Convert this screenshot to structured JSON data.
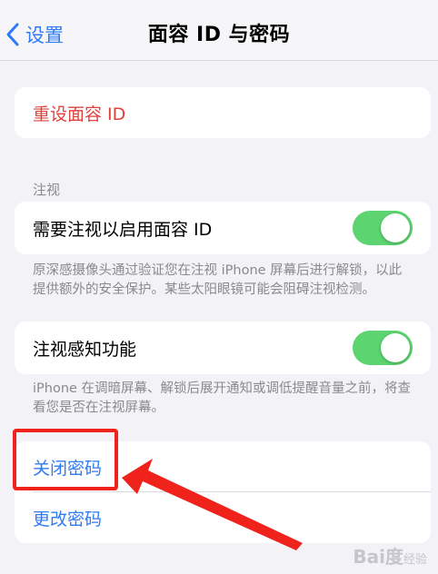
{
  "nav": {
    "back_label": "设置",
    "title": "面容 ID 与密码"
  },
  "reset": {
    "label": "重设面容 ID"
  },
  "attention": {
    "header": "注视",
    "toggle_label": "需要注视以启用面容 ID",
    "toggle_on": true,
    "footer": "原深感摄像头通过验证您在注视 iPhone 屏幕后进行解锁，以此提供额外的安全保护。某些太阳眼镜可能会阻碍注视检测。"
  },
  "aware": {
    "toggle_label": "注视感知功能",
    "toggle_on": true,
    "footer": "iPhone 在调暗屏幕、解锁后展开通知或调低提醒音量之前，将查看您是否在注视屏幕。"
  },
  "passcode": {
    "turn_off_label": "关闭密码",
    "change_label": "更改密码"
  },
  "watermark": {
    "text": "Bai度",
    "sub": "经验"
  },
  "colors": {
    "accent": "#2f7bf6",
    "destructive": "#e0413a",
    "switch_on": "#5cd470",
    "annotation": "#f0231c"
  }
}
